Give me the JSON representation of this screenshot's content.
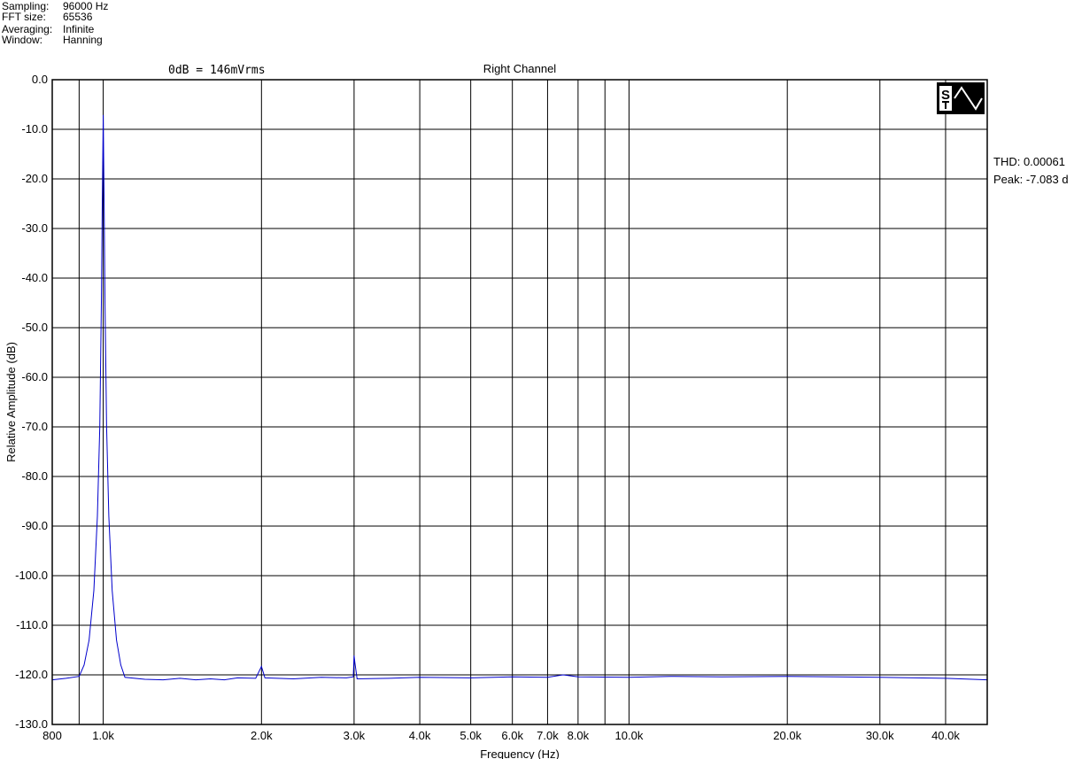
{
  "header": {
    "sampling_label": "Sampling:",
    "sampling_value": "96000 Hz",
    "fft_label": "FFT size:",
    "fft_value": "65536",
    "averaging_label": "Averaging:",
    "averaging_value": "Infinite",
    "window_label": "Window:",
    "window_value": "Hanning",
    "reference": "0dB = 146mVrms"
  },
  "readouts": {
    "thd": "THD: 0.00061",
    "peak": "Peak: -7.083 d"
  },
  "logo": {
    "icon": "sa-sine-logo-icon",
    "text": "S"
  },
  "chart_data": {
    "type": "line",
    "title": "Right Channel",
    "xlabel": "Frequency (Hz)",
    "ylabel": "Relative Amplitude (dB)",
    "xscale": "log",
    "xlim": [
      800,
      48000
    ],
    "ylim": [
      -130,
      0
    ],
    "grid": true,
    "line_color": "#0000cc",
    "x_ticks": [
      {
        "value": 800,
        "label": "800"
      },
      {
        "value": 1000,
        "label": "1.0k"
      },
      {
        "value": 2000,
        "label": "2.0k"
      },
      {
        "value": 3000,
        "label": "3.0k"
      },
      {
        "value": 4000,
        "label": "4.0k"
      },
      {
        "value": 5000,
        "label": "5.0k"
      },
      {
        "value": 6000,
        "label": "6.0k"
      },
      {
        "value": 7000,
        "label": "7.0k"
      },
      {
        "value": 8000,
        "label": "8.0k"
      },
      {
        "value": 10000,
        "label": "10.0k"
      },
      {
        "value": 20000,
        "label": "20.0k"
      },
      {
        "value": 30000,
        "label": "30.0k"
      },
      {
        "value": 40000,
        "label": "40.0k"
      }
    ],
    "x_grid_extra": [
      900,
      9000
    ],
    "y_ticks": [
      {
        "value": 0,
        "label": "0.0"
      },
      {
        "value": -10,
        "label": "-10.0"
      },
      {
        "value": -20,
        "label": "-20.0"
      },
      {
        "value": -30,
        "label": "-30.0"
      },
      {
        "value": -40,
        "label": "-40.0"
      },
      {
        "value": -50,
        "label": "-50.0"
      },
      {
        "value": -60,
        "label": "-60.0"
      },
      {
        "value": -70,
        "label": "-70.0"
      },
      {
        "value": -80,
        "label": "-80.0"
      },
      {
        "value": -90,
        "label": "-90.0"
      },
      {
        "value": -100,
        "label": "-100.0"
      },
      {
        "value": -110,
        "label": "-110.0"
      },
      {
        "value": -120,
        "label": "-120.0"
      },
      {
        "value": -130,
        "label": "-130.0"
      }
    ],
    "series": [
      {
        "points": [
          [
            800,
            -121.0
          ],
          [
            850,
            -120.7
          ],
          [
            900,
            -120.3
          ],
          [
            920,
            -118.0
          ],
          [
            940,
            -113.0
          ],
          [
            960,
            -103.0
          ],
          [
            975,
            -88.0
          ],
          [
            985,
            -70.0
          ],
          [
            992,
            -45.0
          ],
          [
            996,
            -25.0
          ],
          [
            1000,
            -7.1
          ],
          [
            1004,
            -25.0
          ],
          [
            1008,
            -45.0
          ],
          [
            1015,
            -70.0
          ],
          [
            1025,
            -88.0
          ],
          [
            1040,
            -103.0
          ],
          [
            1060,
            -113.0
          ],
          [
            1080,
            -118.0
          ],
          [
            1100,
            -120.5
          ],
          [
            1200,
            -120.9
          ],
          [
            1300,
            -121.0
          ],
          [
            1400,
            -120.7
          ],
          [
            1500,
            -121.0
          ],
          [
            1600,
            -120.8
          ],
          [
            1700,
            -121.0
          ],
          [
            1800,
            -120.6
          ],
          [
            1950,
            -120.7
          ],
          [
            2000,
            -118.3
          ],
          [
            2030,
            -120.6
          ],
          [
            2300,
            -120.8
          ],
          [
            2600,
            -120.5
          ],
          [
            2900,
            -120.6
          ],
          [
            2990,
            -120.4
          ],
          [
            3000,
            -116.1
          ],
          [
            3010,
            -117.5
          ],
          [
            3040,
            -120.8
          ],
          [
            3500,
            -120.7
          ],
          [
            4000,
            -120.5
          ],
          [
            5000,
            -120.6
          ],
          [
            6000,
            -120.4
          ],
          [
            7000,
            -120.5
          ],
          [
            7500,
            -120.0
          ],
          [
            8000,
            -120.4
          ],
          [
            10000,
            -120.5
          ],
          [
            12000,
            -120.3
          ],
          [
            15000,
            -120.4
          ],
          [
            20000,
            -120.3
          ],
          [
            25000,
            -120.4
          ],
          [
            30000,
            -120.5
          ],
          [
            35000,
            -120.6
          ],
          [
            40000,
            -120.7
          ],
          [
            45000,
            -120.9
          ],
          [
            48000,
            -121.0
          ]
        ]
      }
    ]
  }
}
